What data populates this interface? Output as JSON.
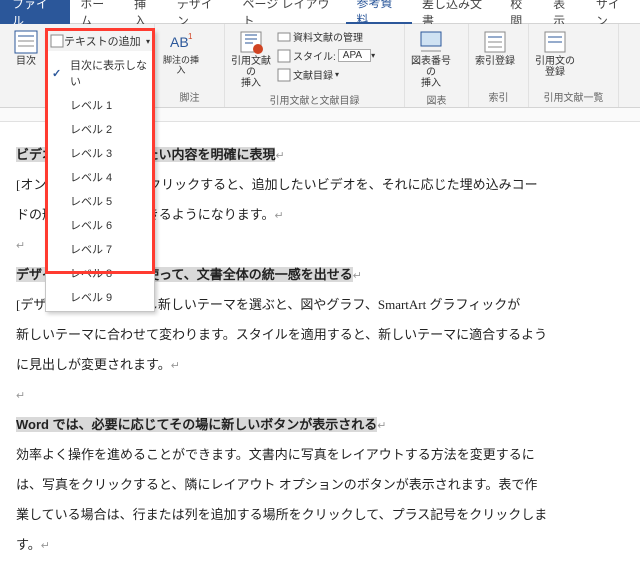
{
  "tabs": {
    "file": "ファイル",
    "items": [
      "ホーム",
      "挿入",
      "デザイン",
      "ページ レイアウト",
      "参考資料",
      "差し込み文書",
      "校閲",
      "表示",
      "サイン"
    ],
    "active_index": 4
  },
  "ribbon": {
    "toc": {
      "label": "目次",
      "add_text": "テキストの追加"
    },
    "footnote": {
      "insert": "脚注の挿入",
      "group_label": "脚注"
    },
    "citation": {
      "insert": "引用文献の\n挿入",
      "manage": "資料文献の管理",
      "style_lbl": "スタイル:",
      "style_val": "APA",
      "biblio": "文献目録",
      "group_label": "引用文献と文献目録"
    },
    "caption": {
      "insert": "図表番号の\n挿入",
      "group_label": "図表"
    },
    "index": {
      "mark": "索引登録",
      "group_label": "索引"
    },
    "authorities": {
      "mark": "引用文の\n登録",
      "group_label": "引用文献一覧"
    }
  },
  "dropdown": {
    "trigger": "テキストの追加",
    "items": [
      "目次に表示しない",
      "レベル 1",
      "レベル 2",
      "レベル 3",
      "レベル 4",
      "レベル 5",
      "レベル 6",
      "レベル 7",
      "レベル 8",
      "レベル 9"
    ],
    "checked_index": 0
  },
  "document": {
    "h1": "ビデオを使うと、伝えたい内容を明確に表現",
    "p1a": "[オンライン ビデオ] をクリックすると、追加したいビデオを、それに応じた埋め込みコー",
    "p1b": "ドの形式で貼り付けできるようになります。",
    "h2": "デザインとスタイルを使って、文書全体の統一感を出せる",
    "p2a": "[デザイン] をクリックし新しいテーマを選ぶと、図やグラフ、SmartArt グラフィックが",
    "p2b": "新しいテーマに合わせて変わります。スタイルを適用すると、新しいテーマに適合するよう",
    "p2c": "に見出しが変更されます。",
    "h3": "Word では、必要に応じてその場に新しいボタンが表示される",
    "p3a": "効率よく操作を進めることができます。文書内に写真をレイアウトする方法を変更するに",
    "p3b": "は、写真をクリックすると、隣にレイアウト オプションのボタンが表示されます。表で作",
    "p3c": "業している場合は、行または列を追加する場所をクリックして、プラス記号をクリックしま",
    "p3d": "す。"
  }
}
